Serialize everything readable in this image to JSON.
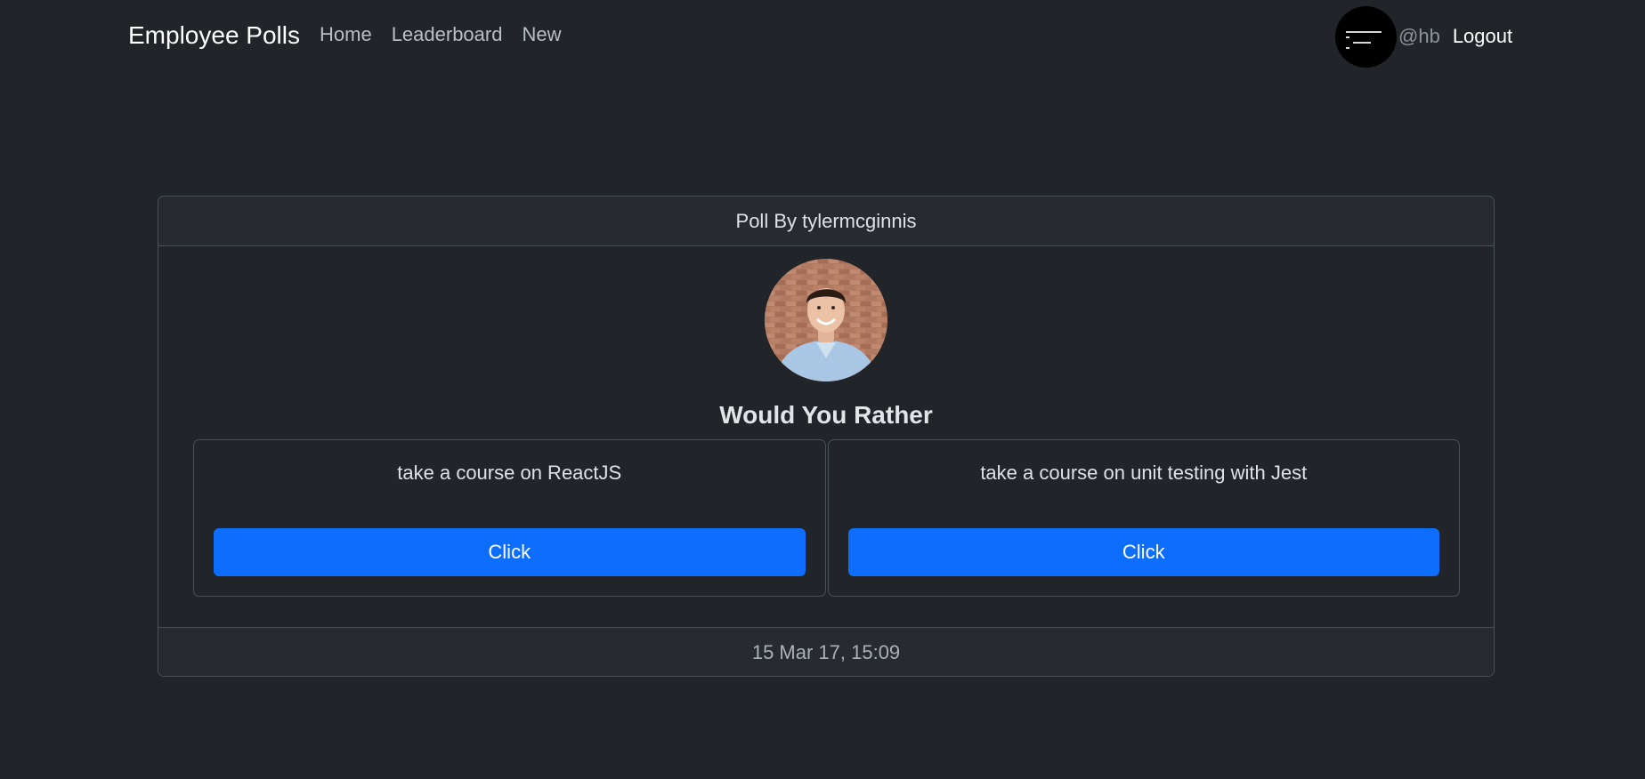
{
  "navbar": {
    "brand": "Employee Polls",
    "links": [
      "Home",
      "Leaderboard",
      "New"
    ],
    "user_handle": "@hb",
    "logout_label": "Logout"
  },
  "poll": {
    "header": "Poll By tylermcginnis",
    "title": "Would You Rather",
    "options": [
      {
        "text": "take a course on ReactJS",
        "button": "Click"
      },
      {
        "text": "take a course on unit testing with Jest",
        "button": "Click"
      }
    ],
    "timestamp": "15 Mar 17, 15:09"
  },
  "colors": {
    "background": "#212529",
    "primary_button": "#0d6efd",
    "border": "#495057"
  }
}
